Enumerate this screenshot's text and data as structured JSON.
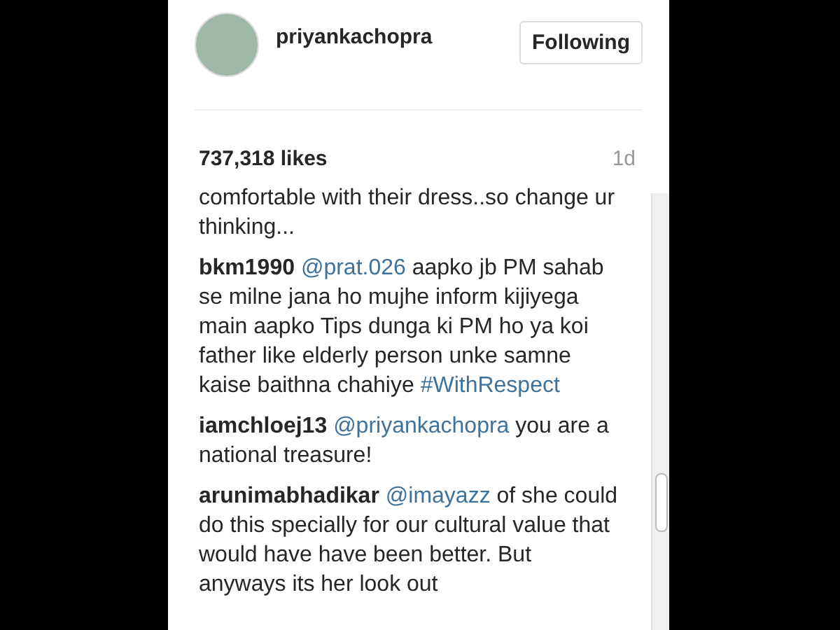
{
  "post_header": {
    "username": "priyankachopra",
    "follow_button": "Following"
  },
  "likes": "737,318 likes",
  "time": "1d",
  "comments": [
    {
      "parts": [
        {
          "kind": "plain",
          "text": "comfortable with their dress..so change ur thinking..."
        }
      ]
    },
    {
      "user": "bkm1990",
      "parts": [
        {
          "kind": "mention",
          "text": "@prat.026"
        },
        {
          "kind": "plain",
          "text": " aapko jb PM sahab se milne jana ho mujhe inform kijiyega main aapko Tips dunga ki PM ho ya koi father like elderly person unke samne kaise baithna chahiye "
        },
        {
          "kind": "hashtag",
          "text": "#WithRespect"
        }
      ]
    },
    {
      "user": "iamchloej13",
      "parts": [
        {
          "kind": "mention",
          "text": "@priyankachopra"
        },
        {
          "kind": "plain",
          "text": " you are a national treasure!"
        }
      ]
    },
    {
      "user": "arunimabhadikar",
      "parts": [
        {
          "kind": "mention",
          "text": "@imayazz"
        },
        {
          "kind": "plain",
          "text": " of she could do this specially for our cultural value that would have have been better. But anyways its her look out"
        }
      ]
    }
  ]
}
